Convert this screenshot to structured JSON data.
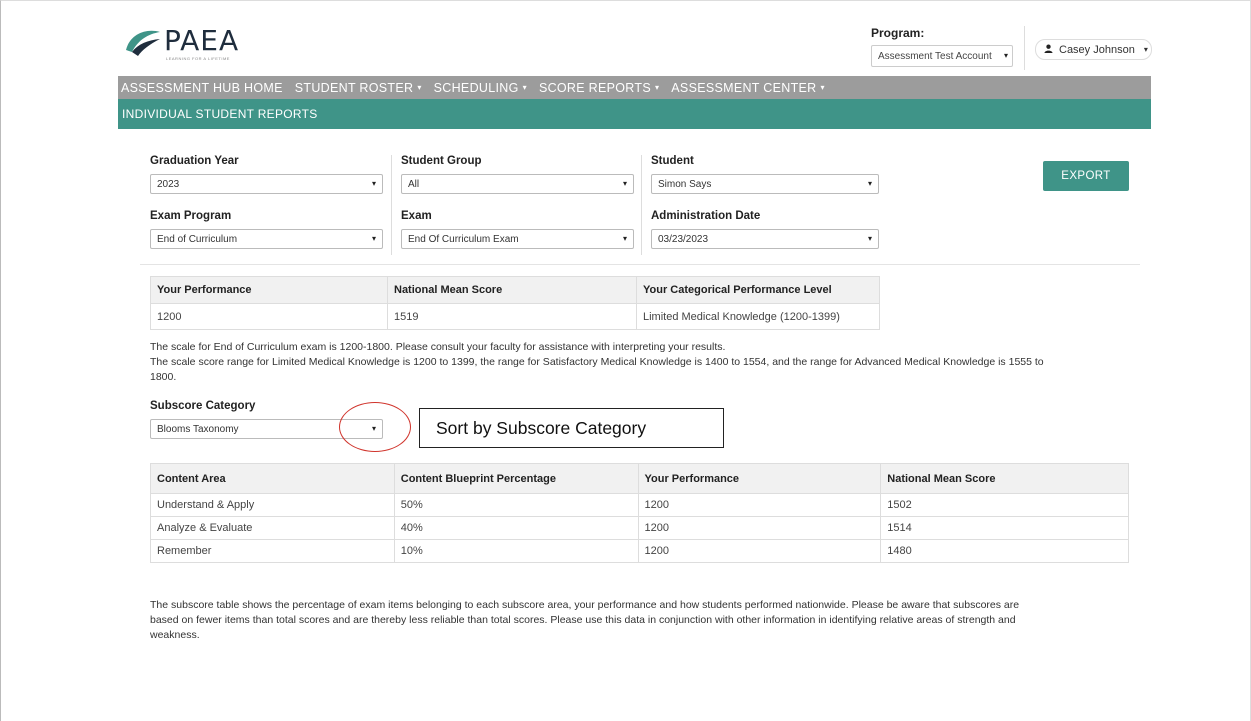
{
  "brand": {
    "name": "PAEA",
    "tagline": "LEARNING FOR A LIFETIME"
  },
  "header": {
    "program_label": "Program:",
    "program_value": "Assessment Test Account",
    "user_name": "Casey Johnson"
  },
  "nav": {
    "items": [
      {
        "label": "ASSESSMENT HUB HOME",
        "dropdown": false
      },
      {
        "label": "STUDENT ROSTER",
        "dropdown": true
      },
      {
        "label": "SCHEDULING",
        "dropdown": true
      },
      {
        "label": "SCORE REPORTS",
        "dropdown": true
      },
      {
        "label": "ASSESSMENT CENTER",
        "dropdown": true
      }
    ],
    "page_title": "INDIVIDUAL STUDENT REPORTS"
  },
  "filters": {
    "graduation_year": {
      "label": "Graduation Year",
      "value": "2023"
    },
    "student_group": {
      "label": "Student Group",
      "value": "All"
    },
    "student": {
      "label": "Student",
      "value": "Simon Says"
    },
    "exam_program": {
      "label": "Exam Program",
      "value": "End of Curriculum"
    },
    "exam": {
      "label": "Exam",
      "value": "End Of Curriculum Exam"
    },
    "administration_date": {
      "label": "Administration Date",
      "value": "03/23/2023"
    }
  },
  "export_label": "EXPORT",
  "performance_table": {
    "headers": [
      "Your Performance",
      "National Mean Score",
      "Your Categorical Performance Level"
    ],
    "row": [
      "1200",
      "1519",
      "Limited Medical Knowledge (1200-1399)"
    ]
  },
  "scale_text": {
    "line1": "The scale for End of Curriculum exam is 1200-1800. Please consult your faculty for assistance with interpreting your results.",
    "line2": "The scale score range for Limited Medical Knowledge is 1200 to 1399, the range for Satisfactory Medical Knowledge is 1400 to 1554, and the range for Advanced Medical Knowledge is 1555 to",
    "line3": "1800."
  },
  "subscore": {
    "label": "Subscore Category",
    "value": "Blooms Taxonomy",
    "callout": "Sort by Subscore Category"
  },
  "subscore_table": {
    "headers": [
      "Content Area",
      "Content Blueprint Percentage",
      "Your Performance",
      "National Mean Score"
    ],
    "rows": [
      [
        "Understand & Apply",
        "50%",
        "1200",
        "1502"
      ],
      [
        "Analyze & Evaluate",
        "40%",
        "1200",
        "1514"
      ],
      [
        "Remember",
        "10%",
        "1200",
        "1480"
      ]
    ]
  },
  "footer_text": {
    "line1": "The subscore table shows the percentage of exam items belonging to each subscore area, your performance and how students performed nationwide. Please be aware that subscores are",
    "line2": "based on fewer items than total scores and are thereby less reliable than total scores. Please use this data in conjunction with other information in identifying relative areas of strength and",
    "line3": "weakness."
  },
  "colors": {
    "nav_gray": "#9c9c9c",
    "teal": "#3f9488",
    "callout_circle": "#d0342c"
  }
}
